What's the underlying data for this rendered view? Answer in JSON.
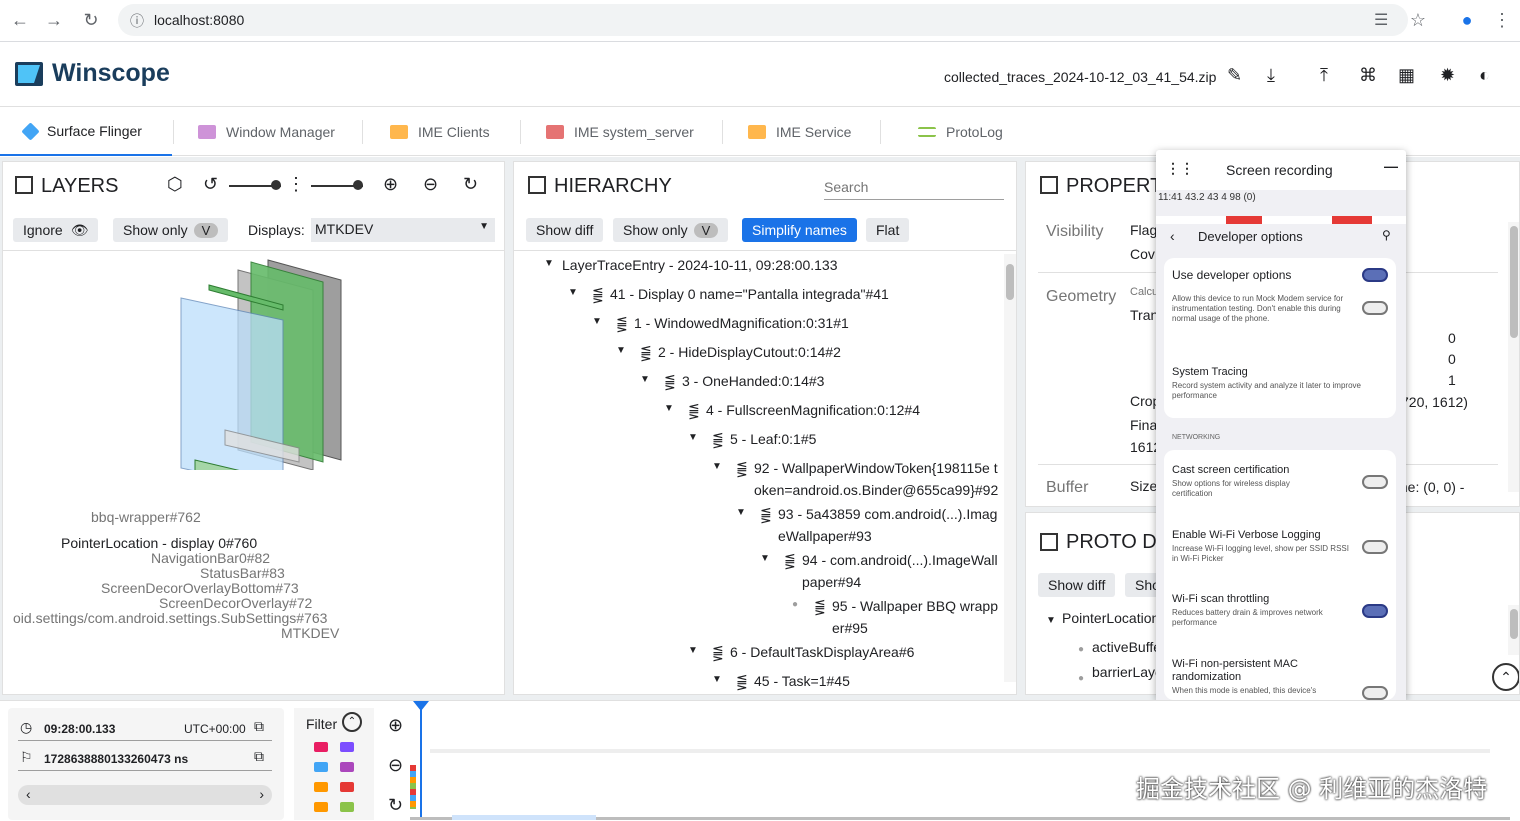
{
  "browser": {
    "url": "localhost:8080"
  },
  "app": {
    "title": "Winscope",
    "filename": "collected_traces_2024-10-12_03_41_54.zip"
  },
  "tabs": [
    {
      "label": "Surface Flinger",
      "color": "#42a5f5"
    },
    {
      "label": "Window Manager",
      "color": "#ab47bc"
    },
    {
      "label": "IME Clients",
      "color": "#ff9800"
    },
    {
      "label": "IME system_server",
      "color": "#e53935"
    },
    {
      "label": "IME Service",
      "color": "#ff9800"
    },
    {
      "label": "ProtoLog",
      "color": "#8bc34a"
    }
  ],
  "layers": {
    "title": "LAYERS",
    "ignore": "Ignore",
    "show_only": "Show only",
    "v": "V",
    "displays_label": "Displays:",
    "display_value": "MTKDEV",
    "labels": [
      "bbq-wrapper#762",
      "PointerLocation - display 0#760",
      "NavigationBar0#82",
      "StatusBar#83",
      "ScreenDecorOverlayBottom#73",
      "ScreenDecorOverlay#72",
      "oid.settings/com.android.settings.SubSettings#763",
      "MTKDEV"
    ]
  },
  "hierarchy": {
    "title": "HIERARCHY",
    "search_placeholder": "Search",
    "show_diff": "Show diff",
    "show_only": "Show only",
    "v": "V",
    "simplify": "Simplify names",
    "flat": "Flat",
    "rows": [
      "LayerTraceEntry - 2024-10-11, 09:28:00.133",
      "41 - Display 0 name=\"Pantalla integrada\"#41",
      "1 - WindowedMagnification:0:31#1",
      "2 - HideDisplayCutout:0:14#2",
      "3 - OneHanded:0:14#3",
      "4 - FullscreenMagnification:0:12#4",
      "5 - Leaf:0:1#5",
      "92 - WallpaperWindowToken{198115e t",
      "oken=android.os.Binder@655ca99}#92",
      "93 - 5a43859 com.android(...).Imag",
      "eWallpaper#93",
      "94 - com.android(...).ImageWall",
      "paper#94",
      "95 - Wallpaper BBQ wrapp",
      "er#95",
      "6 - DefaultTaskDisplayArea#6",
      "45 - Task=1#45"
    ]
  },
  "properties": {
    "title": "PROPERT",
    "visibility": "Visibility",
    "flag": "Flag",
    "cov": "Cov",
    "geometry": "Geometry",
    "calc": "Calcu",
    "tran": "Tran",
    "crop": "Crop",
    "fina": "Fina",
    "n1612": "1612",
    "buffer": "Buffer",
    "size": "Size",
    "values": [
      "0",
      "0",
      "1",
      "720, 1612)"
    ],
    "size_tail": "me: (0, 0) -"
  },
  "proto": {
    "title": "PROTO D",
    "show_diff": "Show diff",
    "sho": "Sho",
    "rows": [
      "PointerLocation",
      "activeBuffe",
      "barrierLaye"
    ]
  },
  "recording": {
    "title": "Screen recording",
    "status_line": "11:41 43.2 43 4 98 (0)",
    "dev_options": "Developer options",
    "items": [
      {
        "title": "Use developer options",
        "sub": "",
        "on": true
      },
      {
        "title": "",
        "sub": "Allow this device to run Mock Modem service for instrumentation testing. Don't enable this during normal usage of the phone.",
        "on": false
      },
      {
        "title": "System Tracing",
        "sub": "Record system activity and analyze it later to improve performance"
      },
      {
        "title": "Cast screen certification",
        "sub": "Show options for wireless display certification",
        "on": false
      },
      {
        "title": "Enable Wi-Fi Verbose Logging",
        "sub": "Increase Wi-Fi logging level, show per SSID RSSI in Wi-Fi Picker",
        "on": false
      },
      {
        "title": "Wi-Fi scan throttling",
        "sub": "Reduces battery drain & improves network performance",
        "on": true
      },
      {
        "title": "Wi-Fi non-persistent MAC randomization",
        "sub": "When this mode is enabled, this device's",
        "on": false
      }
    ],
    "networking": "NETWORKING"
  },
  "timeline": {
    "time": "09:28:00.133",
    "tz": "UTC+00:00",
    "ns": "1728638880133260473 ns",
    "filter": "Filter"
  },
  "watermark": "掘金技术社区 @ 利维亚的杰洛特"
}
